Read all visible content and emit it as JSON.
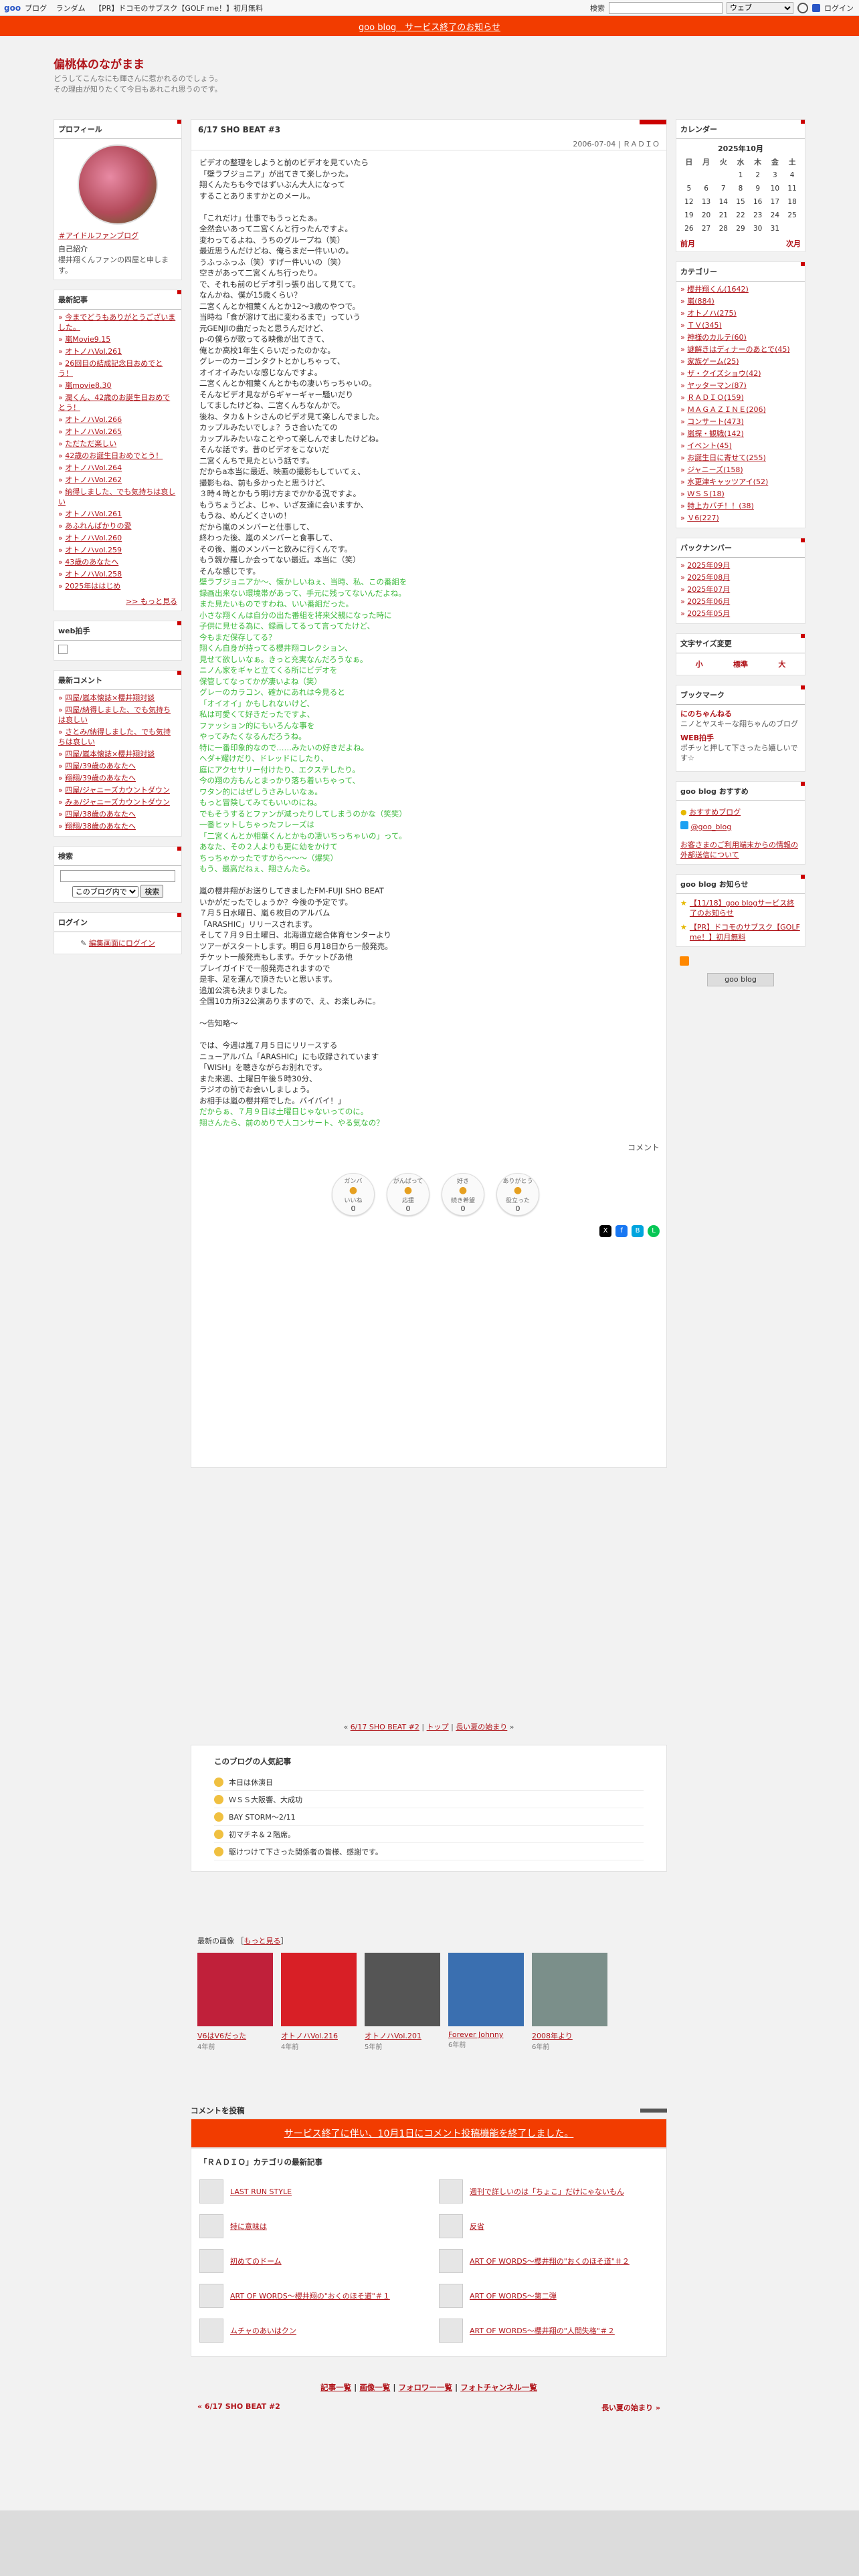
{
  "topbar": {
    "logo": "goo",
    "links": [
      "ブログ",
      "ランダム",
      "【PR】ドコモのサブスク【GOLF me！】初月無料"
    ],
    "search_label": "検索",
    "search_option": "ウェブ",
    "login": "ログイン"
  },
  "notice": "goo blog　サービス終了のお知らせ",
  "blog": {
    "title": "偏桃体のながまま",
    "desc1": "どうしてこんなにも輝さんに惹かれるのでしょう。",
    "desc2": "その理由が知りたくて今日もあれこれ思うのです。"
  },
  "profile": {
    "heading": "プロフィール",
    "link": "＃アイドルファンブログ",
    "intro_label": "自己紹介",
    "intro": "櫻井翔くんファンの四屋と申します。"
  },
  "recent": {
    "heading": "最新記事",
    "items": [
      "今までどうもありがとうございました。",
      "嵐Movie9.15",
      "オトノハVol.261",
      "26回目の結成記念日おめでとう！",
      "嵐movie8.30",
      "潤くん、42歳のお誕生日おめでとう！",
      "オトノハVol.266",
      "オトノハVol.265",
      "ただただ楽しい",
      "42歳のお誕生日おめでとう！",
      "オトノハVol.264",
      "オトノハVol.262",
      "納得しました、でも気持ちは哀しい",
      "オトノハVol.261",
      "あふれんばかりの愛",
      "オトノハVol.260",
      "オトノハvol.259",
      "43歳のあなたへ",
      "オトノハVol.258",
      "2025年ははじめ"
    ],
    "more": ">> もっと見る"
  },
  "webclap": {
    "heading": "web拍手"
  },
  "comments": {
    "heading": "最新コメント",
    "items": [
      "四屋/嵐本懐誌×櫻井翔対談",
      "四屋/納得しました、でも気持ちは哀しい",
      "さとみ/納得しました、でも気持ちは哀しい",
      "四屋/嵐本懐誌×櫻井翔対談",
      "四屋/39歳のあなたへ",
      "翔翔/39歳のあなたへ",
      "四屋/ジャニーズカウントダウン",
      "みぁ/ジャニーズカウントダウン",
      "四屋/38歳のあなたへ",
      "翔翔/38歳のあなたへ"
    ]
  },
  "search": {
    "heading": "検索",
    "select": "このブログ内で",
    "button": "検索"
  },
  "login": {
    "heading": "ログイン",
    "link": "編集画面にログイン"
  },
  "post": {
    "title": "6/17 SHO BEAT #3",
    "date": "2006-07-04 | ＲＡＤＩＯ",
    "lines": [
      {
        "t": "ビデオの整理をしようと前のビデオを見ていたら",
        "g": false
      },
      {
        "t": "「壁ラブジョニア」が出てきて楽しかった。",
        "g": false
      },
      {
        "t": "翔くんたちも今ではずいぶん大人になって",
        "g": false
      },
      {
        "t": "することありますかとのメール。",
        "g": false
      },
      {
        "t": "",
        "g": false
      },
      {
        "t": "「これだけ」仕事でもうっとたぁ。",
        "g": false
      },
      {
        "t": "全然会いあって二宮くんと行ったんですよ。",
        "g": false
      },
      {
        "t": "変わってるよね、うちのグループね（笑）",
        "g": false
      },
      {
        "t": "最近思うんだけどね、俺らまだ一件いいの。",
        "g": false
      },
      {
        "t": "うふっふっふ（笑）すげー件いいの（笑）",
        "g": false
      },
      {
        "t": "空きがあって二宮くんち行ったり。",
        "g": false
      },
      {
        "t": "で、それも前のビデオ引っ張り出して見てて。",
        "g": false
      },
      {
        "t": "なんかね、僕が15歳くらい？",
        "g": false
      },
      {
        "t": "二宮くんとか相葉くんとか12～3歳のやつで。",
        "g": false
      },
      {
        "t": "当時ね「食が溶けて出に変わるまで」っていう",
        "g": false
      },
      {
        "t": "元GENJIの曲だったと思うんだけど、",
        "g": false
      },
      {
        "t": "p-の僕らが歌ってる映像が出てきて、",
        "g": false
      },
      {
        "t": "俺とか高校1年生くらいだったのかな。",
        "g": false
      },
      {
        "t": "グレーのカーゴンタクトとかしちゃって、",
        "g": false
      },
      {
        "t": "オイオイみたいな感じなんですよ。",
        "g": false
      },
      {
        "t": "二宮くんとか相葉くんとかもの凄いちっちゃいの。",
        "g": false
      },
      {
        "t": "そんなビデオ見ながらギャーギャー騒いだり",
        "g": false
      },
      {
        "t": "してましたけどね、二宮くんちなんかで。",
        "g": false
      },
      {
        "t": "後ね、タカ＆トシさんのビデオ見て楽しんでました。",
        "g": false
      },
      {
        "t": "カップルみたいでしょ？うさ合いたての",
        "g": false
      },
      {
        "t": "カップルみたいなことやって楽しんでましたけどね。",
        "g": false
      },
      {
        "t": "そんな話です。昔のビデオをこないだ",
        "g": false
      },
      {
        "t": "二宮くんちで見たという話です。",
        "g": false
      },
      {
        "t": "だからa本当に最近、映画の撮影もしていてぇ、",
        "g": false
      },
      {
        "t": "撮影もね、前も多かったと思うけど、",
        "g": false
      },
      {
        "t": "３時４時とかもう明け方までかかる況ですよ。",
        "g": false
      },
      {
        "t": "もうちょうどよ、じゃ、いざ友達に会いますか、",
        "g": false
      },
      {
        "t": "もうね、めんどくさいの！",
        "g": false
      },
      {
        "t": "だから嵐のメンバーと仕事して、",
        "g": false
      },
      {
        "t": "終わった後、嵐のメンバーと食事して、",
        "g": false
      },
      {
        "t": "その後、嵐のメンバーと飲みに行くんです。",
        "g": false
      },
      {
        "t": "もう親か羅しか会ってない最近。本当に（笑）",
        "g": false
      },
      {
        "t": "そんな感じです。",
        "g": false
      },
      {
        "t": "壁ラブジョニアか～、懐かしいねぇ、当時、私、この番組を",
        "g": true
      },
      {
        "t": "録画出来ない環境帯があって、手元に残ってないんだよね。",
        "g": true
      },
      {
        "t": "また見たいものですわね、いい番組だった。",
        "g": true
      },
      {
        "t": "小さな翔くんは自分の出た番組を将来父親になった時に",
        "g": true
      },
      {
        "t": "子供に見せる為に、録画してるって言ってたけど、",
        "g": true
      },
      {
        "t": "今もまだ保存してる？",
        "g": true
      },
      {
        "t": "翔くん自身が持ってる櫻井翔コレクション、",
        "g": true
      },
      {
        "t": "見せて欲しいなぁ。きっと充実なんだろうなぁ。",
        "g": true
      },
      {
        "t": "ニノん家をギャと立てくる所にビデオを",
        "g": true
      },
      {
        "t": "保管してなってかが凄いよね（笑）",
        "g": true
      },
      {
        "t": "グレーのカラコン、確かにあれは今見ると",
        "g": true
      },
      {
        "t": "「オイオイ」かもしれないけど、",
        "g": true
      },
      {
        "t": "私は可愛くて好きだったですよ、",
        "g": true
      },
      {
        "t": "ファッション的にもいろんな事を",
        "g": true
      },
      {
        "t": "やってみたくなるんだろうね。",
        "g": true
      },
      {
        "t": "特に一番印象的なので……みたいの好きだよね。",
        "g": true
      },
      {
        "t": "ヘダ+耀けだり、ドレッドにしたり、",
        "g": true
      },
      {
        "t": "庭にアクセサリー付けたり、エクステしたり。",
        "g": true
      },
      {
        "t": "今の翔の方もんとまっかり落ち着いちゃって、",
        "g": true
      },
      {
        "t": "ワタン的にはぜしうさみしいなぁ。",
        "g": true
      },
      {
        "t": "もっと冒険してみてもいいのにね。",
        "g": true
      },
      {
        "t": "でもそうするとファンが減ったりしてしまうのかな（笑笑）",
        "g": true
      },
      {
        "t": "一番ヒットしちゃったフレーズは",
        "g": true
      },
      {
        "t": "「二宮くんとか相葉くんとかもの凄いちっちゃいの」って。",
        "g": true
      },
      {
        "t": "あなた、その２人よりも更に幼をかけて",
        "g": true
      },
      {
        "t": "ちっちゃかったですから～～～（爆笑）",
        "g": true
      },
      {
        "t": "もう、最高だねぇ、翔さんたら。",
        "g": true
      },
      {
        "t": "",
        "g": false
      },
      {
        "t": "嵐の櫻井翔がお送りしてきましたFM-FUJI SHO BEAT",
        "g": false
      },
      {
        "t": "いかがだったでしょうか？今後の予定です。",
        "g": false
      },
      {
        "t": "７月５日水曜日、嵐６枚目のアルバム",
        "g": false
      },
      {
        "t": "「ARASHIC」リリースされます。",
        "g": false
      },
      {
        "t": "そして７月９日土曜日、北海道立総合体育センターより",
        "g": false
      },
      {
        "t": "ツアーがスタートします。明日６月18日から一般発売。",
        "g": false
      },
      {
        "t": "チケット一般発売もします。チケットぴあ他",
        "g": false
      },
      {
        "t": "プレイガイドで一般発売されますので",
        "g": false
      },
      {
        "t": "是非、足を運んで頂きたいと思います。",
        "g": false
      },
      {
        "t": "追加公演も決まりました。",
        "g": false
      },
      {
        "t": "全国10カ所32公演ありますので、え、お楽しみに。",
        "g": false
      },
      {
        "t": "",
        "g": false
      },
      {
        "t": "～告知略～",
        "g": false
      },
      {
        "t": "",
        "g": false
      },
      {
        "t": "では、今週は嵐７月５日にリリースする",
        "g": false
      },
      {
        "t": "ニューアルバム「ARASHIC」にも収録されています",
        "g": false
      },
      {
        "t": "「WISH」を聴きながらお別れです。",
        "g": false
      },
      {
        "t": "また来週、土曜日午後５時30分、",
        "g": false
      },
      {
        "t": "ラジオの前でお会いしましょう。",
        "g": false
      },
      {
        "t": "お相手は嵐の櫻井翔でした。バイバイ！」",
        "g": false
      },
      {
        "t": "だからぁ、７月９日は土曜日じゃないってのに。",
        "g": true
      },
      {
        "t": "翔さんたら、前のめりで人コンサート、やる気なの？",
        "g": true
      }
    ],
    "comment_link": "コメント",
    "reactions": [
      {
        "top": "ガンバ",
        "label": "いいね",
        "count": "0"
      },
      {
        "top": "がんばって",
        "label": "応援",
        "count": "0"
      },
      {
        "top": "好き",
        "label": "続き希望",
        "count": "0"
      },
      {
        "top": "ありがとう",
        "label": "役立った",
        "count": "0"
      }
    ]
  },
  "pager": {
    "prev": "6/17 SHO BEAT #2",
    "top": "トップ",
    "next": "長い夏の始まり"
  },
  "popular": {
    "heading": "このブログの人気記事",
    "items": [
      "本日は休演日",
      "ＷＳＳ大阪響、大成功",
      "BAY STORM～2/11",
      "初マチネ＆２階席。",
      "駆けつけて下さった関係者の皆様、感謝です。"
    ]
  },
  "images": {
    "label": "最新の画像",
    "more": "もっと見る",
    "items": [
      {
        "c": "V6はV6だった",
        "d": "4年前",
        "col": "#c0203a"
      },
      {
        "c": "オトノハVol.216",
        "d": "4年前",
        "col": "#d81f26"
      },
      {
        "c": "オトノハVol.201",
        "d": "5年前",
        "col": "#555555"
      },
      {
        "c": "Forever Johnny",
        "d": "6年前",
        "col": "#3a6fb0"
      },
      {
        "c": "2008年より",
        "d": "6年前",
        "col": "#7b8f8a"
      }
    ]
  },
  "cform": {
    "label": "コメントを投稿",
    "notice": "サービス終了に伴い、10月1日にコメント投稿機能を終了しました。"
  },
  "category_latest": {
    "heading": "「ＲＡＤＩＯ」カテゴリの最新記事",
    "items": [
      "LAST RUN STYLE",
      "週刊で詳しいのは「ちょこ」だけにゃないもん",
      "特に意味は",
      "反省",
      "初めてのドーム",
      "ART OF WORDS～櫻井翔の\"おくのほそ道\"＃２",
      "ART OF WORDS～櫻井翔の\"おくのほそ道\"＃１",
      "ART OF WORDS～第二弾",
      "ムチャのあいはクン",
      "ART OF WORDS～櫻井翔の\"人間失格\"＃２"
    ]
  },
  "footer": {
    "links": [
      "記事一覧",
      "画像一覧",
      "フォロワー一覧",
      "フォトチャンネル一覧"
    ],
    "prev": "« 6/17 SHO BEAT #2",
    "next": "長い夏の始まり »"
  },
  "calendar": {
    "heading": "カレンダー",
    "month": "2025年10月",
    "dows": [
      "日",
      "月",
      "火",
      "水",
      "木",
      "金",
      "土"
    ],
    "weeks": [
      [
        "",
        "",
        "",
        "1",
        "2",
        "3",
        "4"
      ],
      [
        "5",
        "6",
        "7",
        "8",
        "9",
        "10",
        "11"
      ],
      [
        "12",
        "13",
        "14",
        "15",
        "16",
        "17",
        "18"
      ],
      [
        "19",
        "20",
        "21",
        "22",
        "23",
        "24",
        "25"
      ],
      [
        "26",
        "27",
        "28",
        "29",
        "30",
        "31",
        ""
      ]
    ],
    "prev": "前月",
    "next": "次月"
  },
  "categories": {
    "heading": "カテゴリー",
    "items": [
      "櫻井翔くん(1642)",
      "嵐(884)",
      "オトノハ(275)",
      "ＴＶ(345)",
      "神様のカルテ(60)",
      "謎解きはディナーのあとで(45)",
      "家族ゲーム(25)",
      "ザ・クイズショウ(42)",
      "ヤッターマン(87)",
      "ＲＡＤＩＯ(159)",
      "ＭＡＧＡＺＩＮＥ(206)",
      "コンサート(473)",
      "嵐探・観戦(142)",
      "イベント(45)",
      "お誕生日に寄せて(255)",
      "ジャニーズ(158)",
      "水更津キャッツアイ(52)",
      "ＷＳＳ(18)",
      "特上カバチ！！(38)",
      "Ｖ6(227)"
    ]
  },
  "backnumber": {
    "heading": "バックナンバー",
    "items": [
      "2025年09月",
      "2025年08月",
      "2025年07月",
      "2025年06月",
      "2025年05月"
    ]
  },
  "fontsize": {
    "heading": "文字サイズ変更",
    "small": "小",
    "mid": "標準",
    "big": "大"
  },
  "bookmark": {
    "heading": "ブックマーク",
    "items": [
      {
        "n": "にのちゃんねる",
        "d": "ニノとヤスキーな翔ちゃんのブログ"
      },
      {
        "n": "WEB拍手",
        "d": "ポチッと押して下さったら嬉しいです☆"
      }
    ]
  },
  "goo_rec": {
    "heading": "goo blog おすすめ",
    "items": [
      "おすすめブログ",
      "@goo_blog"
    ],
    "note": "お客さまのご利用端末からの情報の外部送信について"
  },
  "goo_info": {
    "heading": "goo blog お知らせ",
    "items": [
      "【11/18】goo blogサービス終了のお知らせ",
      "【PR】ドコモのサブスク【GOLF me！】初月無料"
    ],
    "badge": "goo blog"
  }
}
